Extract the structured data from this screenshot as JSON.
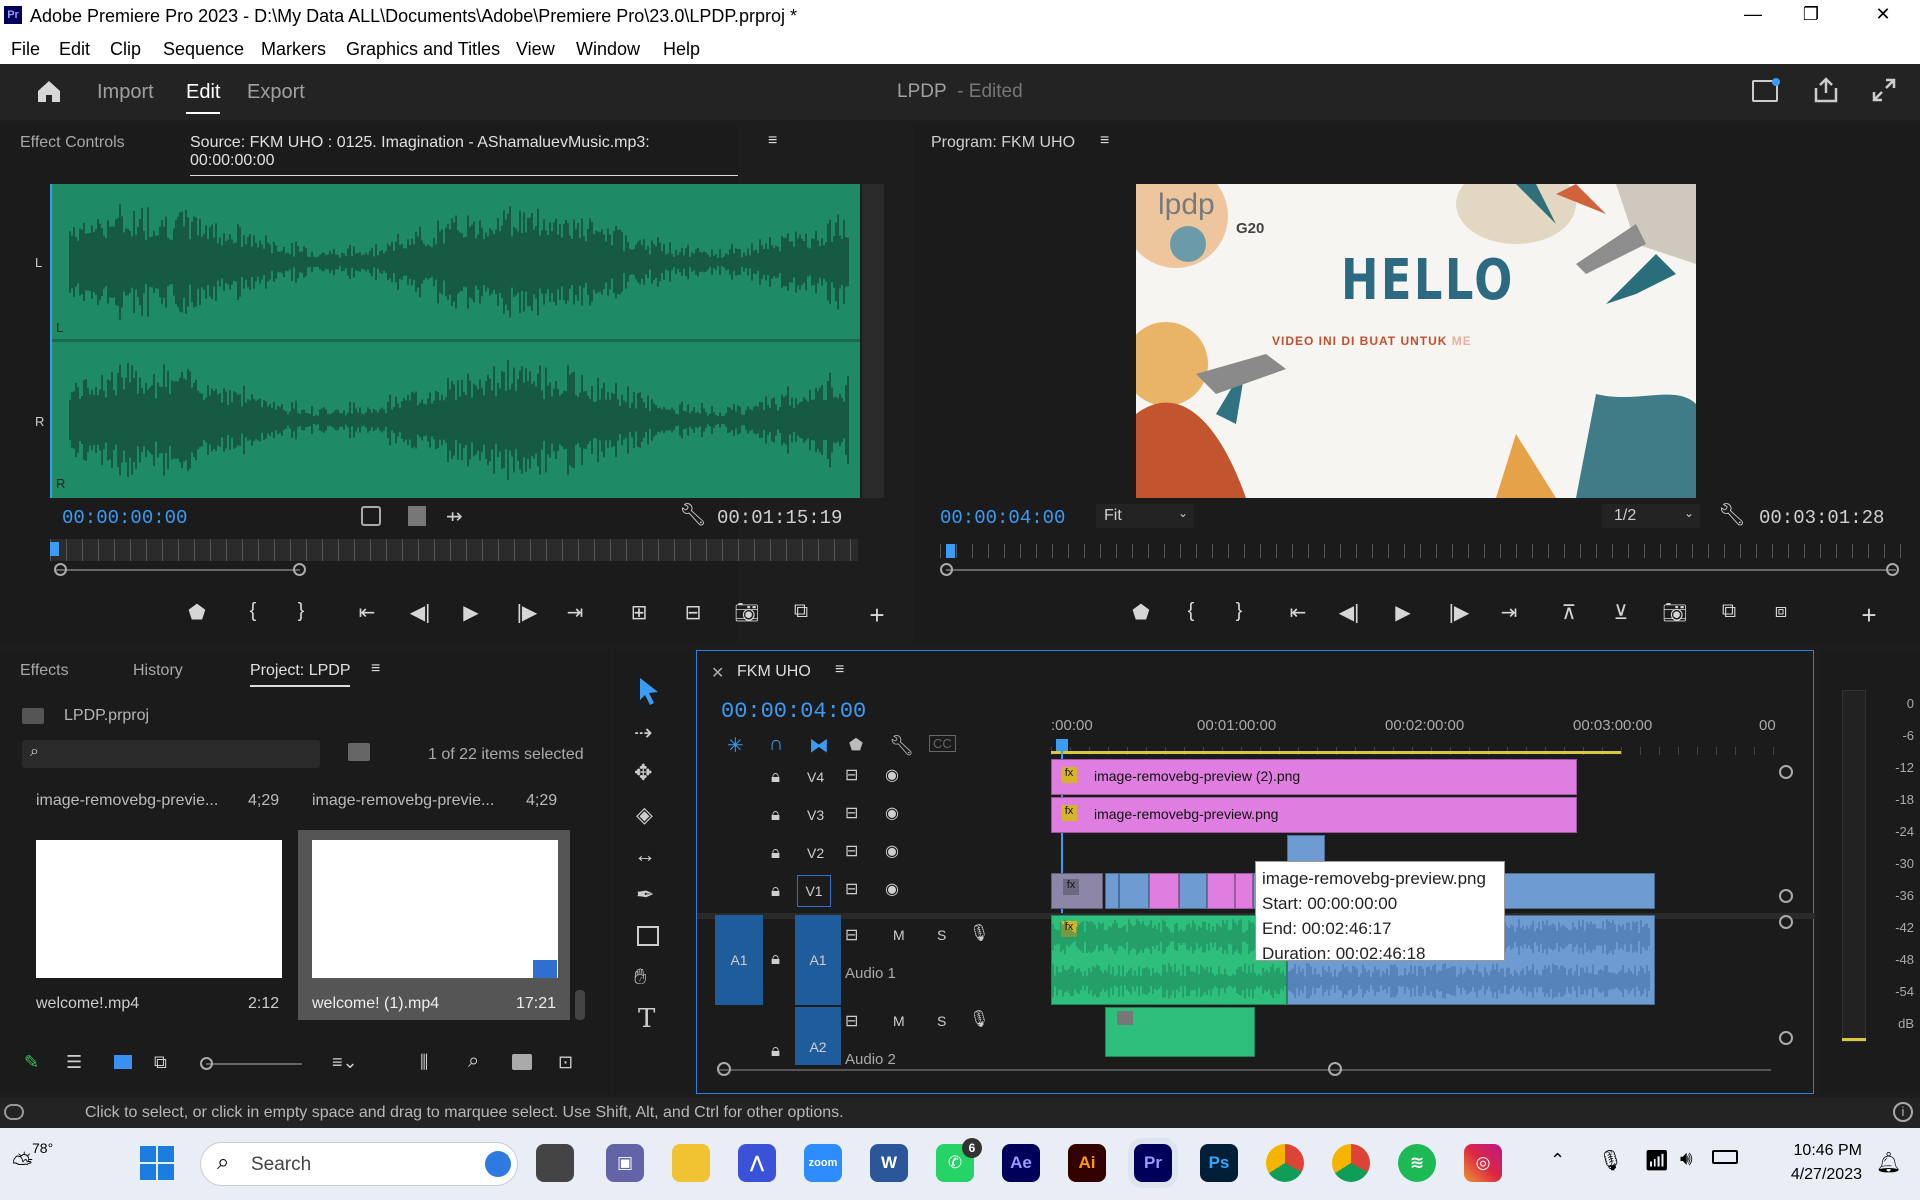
{
  "window": {
    "app_icon": "Pr",
    "title": "Adobe Premiere Pro 2023 - D:\\My Data ALL\\Documents\\Adobe\\Premiere Pro\\23.0\\LPDP.prproj *",
    "minimize": "—",
    "maximize": "❐",
    "close": "✕"
  },
  "menu": [
    "File",
    "Edit",
    "Clip",
    "Sequence",
    "Markers",
    "Graphics and Titles",
    "View",
    "Window",
    "Help"
  ],
  "workspace": {
    "import": "Import",
    "edit": "Edit",
    "export": "Export",
    "project_name": "LPDP",
    "edited": "- Edited"
  },
  "source": {
    "tab_effect_controls": "Effect Controls",
    "tab_source": "Source: FKM UHO : 0125. Imagination - AShamaluevMusic.mp3: 00:00:00:00",
    "label_L": "L",
    "label_R": "R",
    "chan_L": "L",
    "chan_R": "R",
    "timecode": "00:00:00:00",
    "duration": "00:01:15:19",
    "wave_color": "#1e8a66"
  },
  "program": {
    "tab": "Program: FKM UHO",
    "timecode": "00:00:04:00",
    "fit": "Fit",
    "resolution": "1/2",
    "duration": "00:03:01:28",
    "frame": {
      "logo": "lpdp",
      "g20": "G20",
      "hello": "HELLO",
      "subtitle": "VIDEO INI DI BUAT UNTUK",
      "subtitle_tail": "ME"
    }
  },
  "project": {
    "tab_effects": "Effects",
    "tab_history": "History",
    "tab_project": "Project: LPDP",
    "file": "LPDP.prproj",
    "search_placeholder": "",
    "selected_info": "1 of 22 items selected",
    "items": [
      {
        "top_name": "image-removebg-previe...",
        "top_dur": "4;29",
        "name": "welcome!.mp4",
        "dur": "2:12"
      },
      {
        "top_name": "image-removebg-previe...",
        "top_dur": "4;29",
        "name": "welcome! (1).mp4",
        "dur": "17:21"
      }
    ]
  },
  "timeline": {
    "tab": "FKM UHO",
    "timecode": "00:00:04:00",
    "ruler": [
      ":00:00",
      "00:01:00:00",
      "00:02:00:00",
      "00:03:00:00",
      "00"
    ],
    "tracks": {
      "v4": "V4",
      "v3": "V3",
      "v2": "V2",
      "v1": "V1",
      "a1": "A1",
      "a1_src": "A1",
      "a2": "A2",
      "audio1": "Audio 1",
      "audio2": "Audio 2",
      "m": "M",
      "s": "S"
    },
    "clips": {
      "v4": "image-removebg-preview (2).png",
      "v3": "image-removebg-preview.png",
      "fx": "fx"
    },
    "tooltip": {
      "name": "image-removebg-preview.png",
      "start": "Start: 00:00:00:00",
      "end": "End: 00:02:46:17",
      "duration": "Duration: 00:02:46:18"
    },
    "meter_scale": [
      "0",
      "-6",
      "-12",
      "-18",
      "-24",
      "-30",
      "-36",
      "-42",
      "-48",
      "-54",
      "dB"
    ]
  },
  "status": "Click to select, or click in empty space and drag to marquee select. Use Shift, Alt, and Ctrl for other options.",
  "taskbar": {
    "weather": "78°",
    "search": "Search",
    "whatsapp_badge": "6",
    "time": "10:46 PM",
    "date": "4/27/2023",
    "apps": [
      "Ae",
      "Ai",
      "Pr",
      "Ps"
    ]
  }
}
